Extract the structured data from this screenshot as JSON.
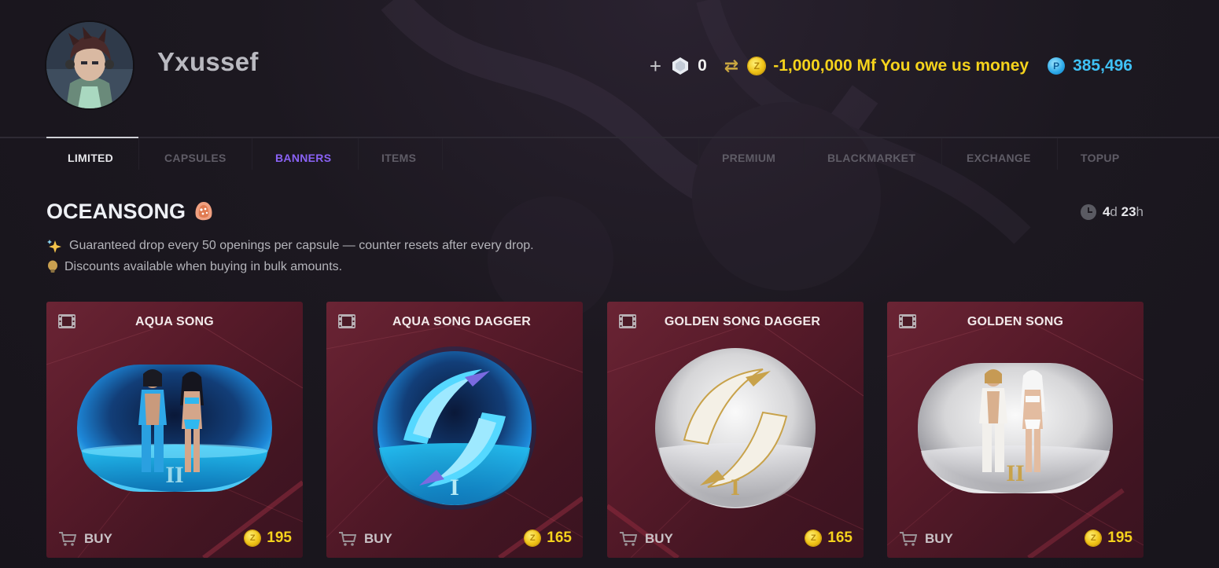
{
  "user": {
    "name": "Yxussef"
  },
  "currencies": {
    "add_label": "+",
    "gems": "0",
    "swap_symbol": "⇄",
    "coins_text": "-1,000,000 Mf You owe us money",
    "premium": "385,496",
    "colors": {
      "gold": "#f5d31c",
      "premium": "#3fc1f5"
    }
  },
  "nav": {
    "left": [
      "LIMITED",
      "CAPSULES",
      "BANNERS",
      "ITEMS"
    ],
    "right": [
      "PREMIUM",
      "BLACKMARKET",
      "EXCHANGE",
      "TOPUP"
    ],
    "active": "LIMITED",
    "highlight": "BANNERS"
  },
  "section": {
    "title": "OCEANSONG",
    "timer": {
      "days": "4",
      "days_unit": "d",
      "hours": "23",
      "hours_unit": "h"
    },
    "info": [
      {
        "icon": "sparkles-icon",
        "text": "Guaranteed drop every 50 openings per capsule — counter resets after every drop."
      },
      {
        "icon": "lightbulb-icon",
        "text": "Discounts available when buying in bulk amounts."
      }
    ]
  },
  "cards": [
    {
      "title": "AQUA SONG",
      "buy_label": "BUY",
      "price": "195",
      "tier": "II",
      "theme": "aqua",
      "shape": "pill"
    },
    {
      "title": "AQUA SONG DAGGER",
      "buy_label": "BUY",
      "price": "165",
      "tier": "I",
      "theme": "aqua",
      "shape": "sphere"
    },
    {
      "title": "GOLDEN SONG DAGGER",
      "buy_label": "BUY",
      "price": "165",
      "tier": "I",
      "theme": "silver",
      "shape": "sphere"
    },
    {
      "title": "GOLDEN SONG",
      "buy_label": "BUY",
      "price": "195",
      "tier": "II",
      "theme": "silver",
      "shape": "pill"
    }
  ]
}
